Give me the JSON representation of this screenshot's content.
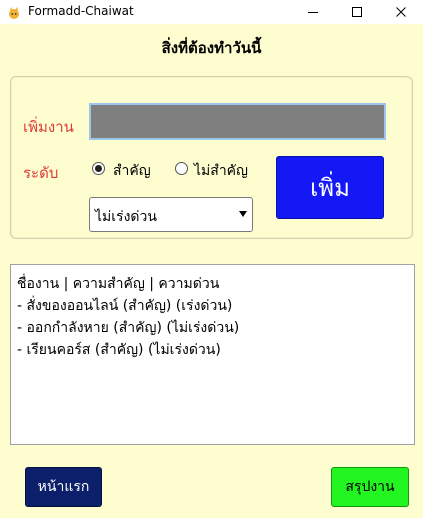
{
  "window": {
    "title": "Formadd-Chaiwat",
    "controls": [
      "minimize-icon",
      "maximize-icon",
      "close-icon"
    ]
  },
  "heading": "สิ่งที่ต้องทำวันนี้",
  "form": {
    "task_label": "เพิ่มงาน",
    "task_value": "",
    "level_label": "ระดับ",
    "radio_important": "สำคัญ",
    "radio_not_important": "ไม่สำคัญ",
    "selected_radio": "สำคัญ",
    "urgency_select": "ไม่เร่งด่วน",
    "add_button": "เพิ่ม"
  },
  "list": {
    "lines": [
      "ชื่องาน | ความสำคัญ | ความด่วน",
      "- สั่งของออนไลน์ (สำคัญ) (เร่งด่วน)",
      "- ออกกำลังหาย (สำคัญ) (ไม่เร่งด่วน)",
      "- เรียนคอร์ส (สำคัญ) (ไม่เร่งด่วน)"
    ]
  },
  "footer": {
    "home_button": "หน้าแรก",
    "summary_button": "สรุปงาน"
  },
  "colors": {
    "background": "#fefdd0",
    "label_red": "#e03b3b",
    "add_button": "#1418f5",
    "home_button": "#0b1f6b",
    "summary_button": "#22f520",
    "input_fill": "#7f7f7f"
  }
}
